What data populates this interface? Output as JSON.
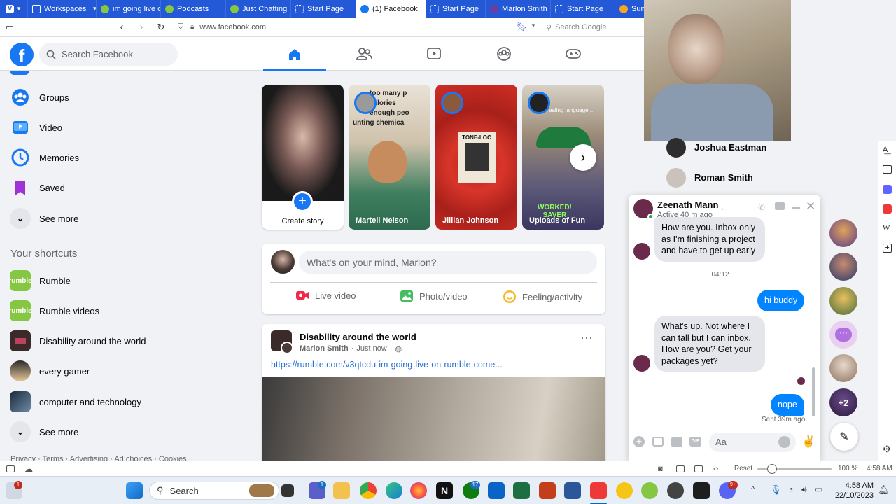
{
  "browser": {
    "tabs": [
      {
        "label": "Workspaces",
        "icon": "workspaces-icon"
      },
      {
        "label": "im going live o",
        "icon": "rumble-icon"
      },
      {
        "label": "Podcasts",
        "icon": "rumble-icon"
      },
      {
        "label": "Just Chatting",
        "icon": "rumble-icon"
      },
      {
        "label": "Start Page",
        "icon": "grid-icon"
      },
      {
        "label": "(1) Facebook",
        "icon": "facebook-icon"
      },
      {
        "label": "Start Page",
        "icon": "grid-icon"
      },
      {
        "label": "Marlon Smith",
        "icon": "twitch-icon"
      },
      {
        "label": "Start Page",
        "icon": "grid-icon"
      },
      {
        "label": "Sun",
        "icon": "sun-icon"
      }
    ],
    "url": "www.facebook.com",
    "search_placeholder": "Search Google"
  },
  "facebook": {
    "search_placeholder": "Search Facebook",
    "menu": [
      {
        "label": "Groups"
      },
      {
        "label": "Video"
      },
      {
        "label": "Memories"
      },
      {
        "label": "Saved"
      },
      {
        "label": "See more"
      }
    ],
    "shortcuts_heading": "Your shortcuts",
    "shortcuts": [
      {
        "label": "Rumble"
      },
      {
        "label": "Rumble videos"
      },
      {
        "label": "Disability around the world"
      },
      {
        "label": "every gamer"
      },
      {
        "label": "computer and technology"
      },
      {
        "label": "See more"
      }
    ],
    "footer": "Privacy · Terms · Advertising · Ad choices · Cookies ·",
    "stories": [
      {
        "label": "Create story"
      },
      {
        "label": "Martell Nelson"
      },
      {
        "label": "Jillian Johnson"
      },
      {
        "label": "Uploads of Fun"
      }
    ],
    "story_texts": [
      "too many p",
      "calories",
      "enough peo",
      "unting chemica",
      "TONE-LOC",
      "ealing language...",
      "WORKED!",
      "SAVER"
    ],
    "composer": {
      "placeholder": "What's on your mind, Marlon?",
      "actions": [
        "Live video",
        "Photo/video",
        "Feeling/activity"
      ]
    },
    "post": {
      "group": "Disability around the world",
      "author": "Marlon Smith",
      "time": "Just now",
      "link": "https://rumble.com/v3qtcdu-im-going-live-on-rumble-come..."
    }
  },
  "contacts": [
    {
      "name": "Joshua Eastman"
    },
    {
      "name": "Roman Smith"
    }
  ],
  "chat": {
    "name": "Zeenath Mann",
    "status": "Active 40 m ago",
    "messages": [
      {
        "from": "them",
        "text": "How are you. Inbox only as I'm finishing a project and have to get up early"
      },
      {
        "from": "time",
        "text": "04:12"
      },
      {
        "from": "me",
        "text": "hi buddy"
      },
      {
        "from": "them",
        "text": "What's up.  Not where I can tall but I can inbox. How are you? Get your packages yet?"
      },
      {
        "from": "me",
        "text": "nope"
      }
    ],
    "sent_status": "Sent 39m ago",
    "input_placeholder": "Aa",
    "more_count": "+2"
  },
  "status_bar": {
    "reset": "Reset",
    "zoom": "100 %",
    "time": "4:58 AM"
  },
  "taskbar": {
    "search": "Search",
    "time": "4:58 AM",
    "date": "22/10/2023",
    "badges": {
      "mail": "1",
      "teams": "1",
      "xbox": "17",
      "discord": "9+"
    }
  }
}
